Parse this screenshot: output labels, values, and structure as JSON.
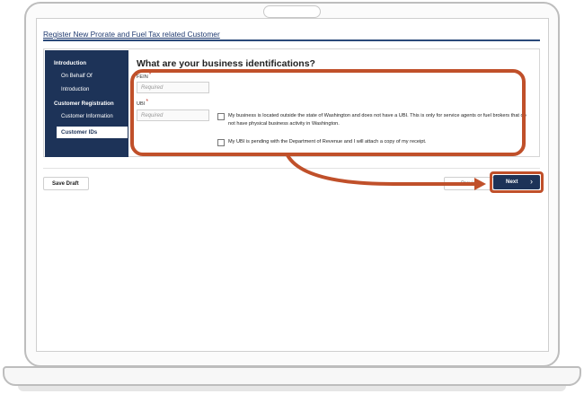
{
  "page": {
    "title": "Register New Prorate and Fuel Tax related Customer"
  },
  "sidebar": {
    "sections": [
      {
        "label": "Introduction",
        "items": [
          {
            "label": "On Behalf Of"
          },
          {
            "label": "Introduction"
          }
        ]
      },
      {
        "label": "Customer Registration",
        "items": [
          {
            "label": "Customer Information"
          },
          {
            "label": "Customer IDs",
            "active": true
          }
        ]
      }
    ]
  },
  "form": {
    "heading": "What are your business identifications?",
    "fein": {
      "label": "FEIN",
      "required_mark": "*",
      "placeholder": "Required",
      "value": ""
    },
    "ubi": {
      "label": "UBI",
      "required_mark": "*",
      "placeholder": "Required",
      "value": ""
    },
    "checkboxes": [
      {
        "label": "My business is located outside the state of Washington and does not have a UBI. This is only for service agents or fuel brokers that do not have physical business activity in Washington.",
        "checked": false
      },
      {
        "label": "My UBI is pending with the Department of Revenue and I will attach a copy of my receipt.",
        "checked": false
      }
    ]
  },
  "actions": {
    "save_draft": "Save Draft",
    "previous": "Previous",
    "next": "Next",
    "next_chevron": "›"
  },
  "colors": {
    "nav": "#1d3358",
    "highlight": "#c0502a",
    "accent_rule": "#2b4a7a"
  }
}
